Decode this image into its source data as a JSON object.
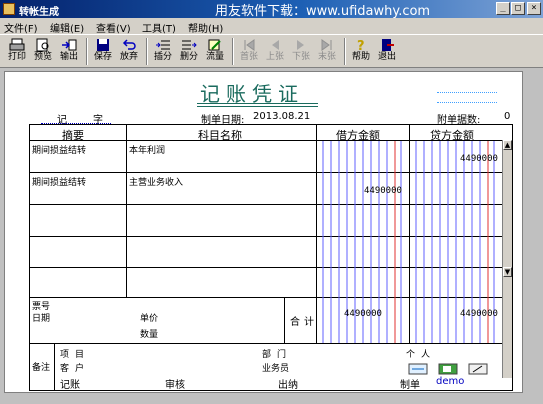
{
  "window": {
    "title": "转帐生成",
    "watermark": "用友软件下载：www.ufidawhy.com"
  },
  "menu": [
    "文件(F)",
    "编辑(E)",
    "查看(V)",
    "工具(T)",
    "帮助(H)"
  ],
  "toolbar": {
    "print": "打印",
    "preview": "预览",
    "export": "输出",
    "save": "保存",
    "discard": "放弃",
    "insert": "插分",
    "delete": "删分",
    "flow": "流量",
    "first": "首张",
    "prev": "上张",
    "next": "下张",
    "last": "末张",
    "help": "帮助",
    "exit": "退出"
  },
  "voucher": {
    "title": "记账凭证",
    "type_label": "记",
    "number_label": "字",
    "date_label": "制单日期:",
    "date_value": "2013.08.21",
    "attachments_label": "附单据数:",
    "attachments_value": "0",
    "headers": {
      "summary": "摘要",
      "account": "科目名称",
      "debit": "借方金额",
      "credit": "贷方金额"
    },
    "rows": [
      {
        "summary": "期间损益结转",
        "account": "本年利润",
        "debit": "",
        "credit": "4490000"
      },
      {
        "summary": "期间损益结转",
        "account": "主营业务收入",
        "debit": "4490000",
        "credit": ""
      },
      {
        "summary": "",
        "account": "",
        "debit": "",
        "credit": ""
      },
      {
        "summary": "",
        "account": "",
        "debit": "",
        "credit": ""
      },
      {
        "summary": "",
        "account": "",
        "debit": "",
        "credit": ""
      }
    ],
    "bill_no_label": "票号",
    "date2_label": "日期",
    "unit_price_label": "单价",
    "quantity_label": "数量",
    "total_label": "合计",
    "total_debit": "4490000",
    "total_credit": "4490000",
    "remark_label": "备注",
    "project_label": "项目",
    "customer_label": "客户",
    "department_label": "部门",
    "salesman_label": "业务员",
    "person_label": "个人"
  },
  "footer": {
    "bookkeeper": "记账",
    "auditor": "审核",
    "cashier": "出纳",
    "maker": "制单",
    "maker_value": "demo"
  }
}
